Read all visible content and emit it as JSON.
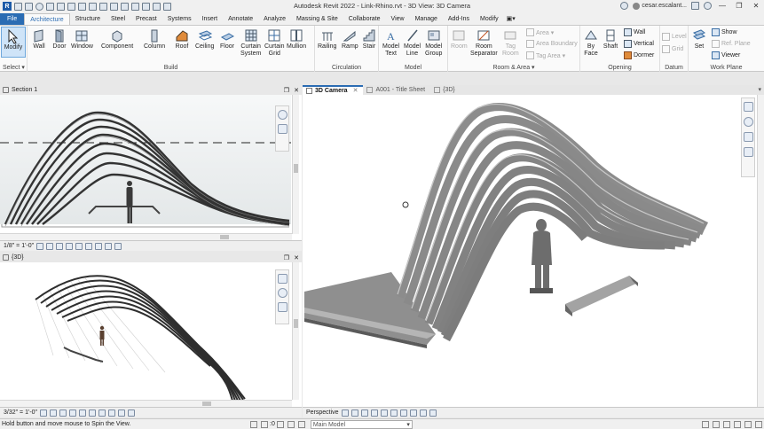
{
  "window": {
    "title": "Autodesk Revit 2022 - Link-Rhino.rvt - 3D View: 3D Camera",
    "user": "cesar.escalant...",
    "minimize": "—",
    "maximize": "❐",
    "close": "✕"
  },
  "ribbon_tabs": [
    {
      "label": "File",
      "state": "file"
    },
    {
      "label": "Architecture",
      "state": "active"
    },
    {
      "label": "Structure",
      "state": ""
    },
    {
      "label": "Steel",
      "state": ""
    },
    {
      "label": "Precast",
      "state": ""
    },
    {
      "label": "Systems",
      "state": ""
    },
    {
      "label": "Insert",
      "state": ""
    },
    {
      "label": "Annotate",
      "state": ""
    },
    {
      "label": "Analyze",
      "state": ""
    },
    {
      "label": "Massing & Site",
      "state": ""
    },
    {
      "label": "Collaborate",
      "state": ""
    },
    {
      "label": "View",
      "state": ""
    },
    {
      "label": "Manage",
      "state": ""
    },
    {
      "label": "Add-Ins",
      "state": ""
    },
    {
      "label": "Modify",
      "state": ""
    }
  ],
  "ribbon": {
    "select": {
      "label": "Modify",
      "dropdown": "Select ▾"
    },
    "build": {
      "label": "Build",
      "tools": [
        "Wall",
        "Door",
        "Window",
        "Component",
        "Column",
        "Roof",
        "Ceiling",
        "Floor",
        "Curtain\nSystem",
        "Curtain\nGrid",
        "Mullion"
      ]
    },
    "circulation": {
      "label": "Circulation",
      "tools": [
        "Railing",
        "Ramp",
        "Stair"
      ]
    },
    "model": {
      "label": "Model",
      "tools": [
        "Model\nText",
        "Model\nLine",
        "Model\nGroup"
      ]
    },
    "room_area": {
      "label": "Room & Area ▾",
      "tools": [
        "Room",
        "Room\nSeparator",
        "Tag\nRoom"
      ],
      "small": [
        "Area ▾",
        "Area Boundary",
        "Tag Area ▾"
      ]
    },
    "opening": {
      "label": "Opening",
      "tools": [
        "By\nFace",
        "Shaft"
      ],
      "small": [
        "Wall",
        "Vertical",
        "Dormer"
      ]
    },
    "datum": {
      "label": "Datum",
      "small": [
        "Level",
        "Grid"
      ]
    },
    "work_plane": {
      "label": "Work Plane",
      "tools": [
        "Set"
      ],
      "small": [
        "Show",
        "Ref. Plane",
        "Viewer"
      ]
    }
  },
  "views": {
    "section": {
      "title": "Section 1",
      "scale": "1/8\" = 1'-0\""
    },
    "three_d_small": {
      "title": "{3D}",
      "scale": "3/32\" = 1'-0\""
    },
    "camera": {
      "mode": "Perspective"
    }
  },
  "view_tabs": [
    {
      "label": "3D Camera",
      "active": true
    },
    {
      "label": "A001 - Title Sheet",
      "active": false
    },
    {
      "label": "{3D}",
      "active": false
    }
  ],
  "status": {
    "hint": "Hold button and move mouse to Spin the View.",
    "model": "Main Model",
    "count": ":0"
  }
}
